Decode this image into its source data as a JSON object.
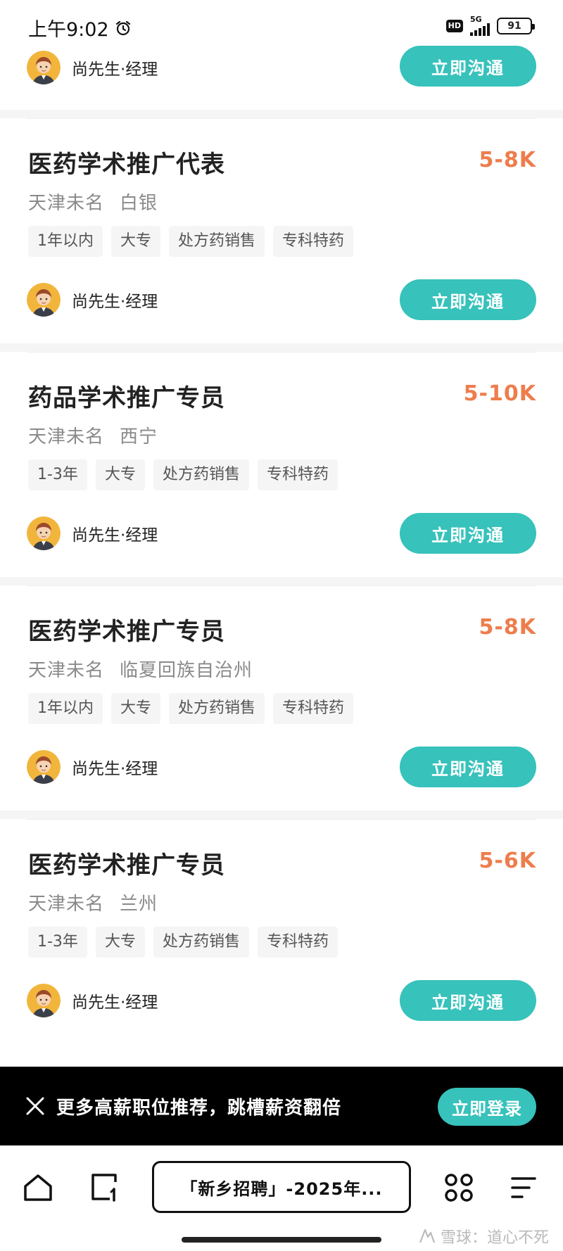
{
  "status_bar": {
    "time": "上午9:02",
    "hd": "HD",
    "network": "5G",
    "battery": "91"
  },
  "top_recruiter": {
    "name": "尚先生·经理",
    "button": "立即沟通"
  },
  "jobs": [
    {
      "title": "医药学术推广代表",
      "salary": "5-8K",
      "company": "天津未名",
      "city": "白银",
      "tags": [
        "1年以内",
        "大专",
        "处方药销售",
        "专科特药"
      ],
      "recruiter": "尚先生·经理",
      "button": "立即沟通"
    },
    {
      "title": "药品学术推广专员",
      "salary": "5-10K",
      "company": "天津未名",
      "city": "西宁",
      "tags": [
        "1-3年",
        "大专",
        "处方药销售",
        "专科特药"
      ],
      "recruiter": "尚先生·经理",
      "button": "立即沟通"
    },
    {
      "title": "医药学术推广专员",
      "salary": "5-8K",
      "company": "天津未名",
      "city": "临夏回族自治州",
      "tags": [
        "1年以内",
        "大专",
        "处方药销售",
        "专科特药"
      ],
      "recruiter": "尚先生·经理",
      "button": "立即沟通"
    },
    {
      "title": "医药学术推广专员",
      "salary": "5-6K",
      "company": "天津未名",
      "city": "兰州",
      "tags": [
        "1-3年",
        "大专",
        "处方药销售",
        "专科特药"
      ],
      "recruiter": "尚先生·经理",
      "button": "立即沟通"
    }
  ],
  "promo": {
    "text": "更多高薪职位推荐，跳槽薪资翻倍",
    "login": "立即登录"
  },
  "browser": {
    "url_title": "「新乡招聘」-2025年...",
    "icons": [
      "home-icon",
      "tabs-icon",
      "apps-icon",
      "menu-icon"
    ]
  },
  "watermark": "雪球：道心不死",
  "colors": {
    "accent": "#37c2bb",
    "salary": "#ee7d4c"
  }
}
